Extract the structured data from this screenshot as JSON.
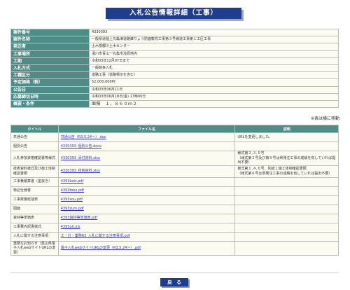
{
  "header": {
    "title": "入札公告情報詳細（工事）"
  },
  "info": [
    {
      "label": "案件番号",
      "value": "4330393"
    },
    {
      "label": "案件名称",
      "value": "一般県道陸上丸亀津道路維りょう防面軟充工事第３号線道工事第１工区工事"
    },
    {
      "label": "発注者",
      "value": "土木部都川土木センター"
    },
    {
      "label": "工事場所",
      "value": "湯川市青山一丸亀市浅見地内"
    },
    {
      "label": "工期",
      "value": "令和03年12月07日まで"
    },
    {
      "label": "入札方式",
      "value": "一般競争入札"
    },
    {
      "label": "工種区分",
      "value": "道路工事（道路標示を含む）"
    },
    {
      "label": "予定価格（税）",
      "value": "52,000,000円"
    },
    {
      "label": "公告日",
      "value": "令和03年06月11日"
    },
    {
      "label": "応募締切日時",
      "value": "令和03年06月18日(金) 17時00分"
    },
    {
      "label": "概要・条件",
      "value": "面積　１，８６０ｍ２"
    }
  ],
  "note": "※表は横に移動",
  "files": {
    "headers": [
      "タイトル",
      "ファイル名",
      "説明"
    ],
    "rows": [
      {
        "title": "共通公告",
        "file": "共通公告（R3.5.24～）.doc",
        "desc": "URLを変更しました。"
      },
      {
        "title": "個別公告",
        "file": "4330393_個別公告.docx",
        "desc": ""
      },
      {
        "title": "入札参加資格確認書等様式",
        "file": "4330393_添付資料.xlsx",
        "desc": "様式第２,３,５号\n（様式第３号及び第５号は県発注工事の成績を有していれば提出不要）"
      },
      {
        "title": "技術資料様式及び施工体制確認書類",
        "file": "4330393_技術資料.xlsx",
        "desc": "様式第１,４,６号、別紙１施工体制確認書類\n（様式第６号は県発注工事の成績を有していれば提出不要）"
      },
      {
        "title": "工事費積算書（金抜き）",
        "file": "4393kaki.pdf",
        "desc": ""
      },
      {
        "title": "特記仕様書",
        "file": "4393toku.pdf",
        "desc": ""
      },
      {
        "title": "工事数量総括表",
        "file": "4393sou.pdf",
        "desc": ""
      },
      {
        "title": "図面",
        "file": "4393zum.pdf",
        "desc": ""
      },
      {
        "title": "資材等単価表",
        "file": "4393資材等単価表.pdf",
        "desc": ""
      },
      {
        "title": "工事費内訳書様式",
        "file": "4393uti.xls",
        "desc": ""
      },
      {
        "title": "入札に関する注意事項",
        "file": "工・計・業務R2_入札に関する注意事項.pdf",
        "desc": ""
      },
      {
        "title": "重要なお知らせ（嘉山県電子入札webサイトURLの変更）",
        "file": "電子入札webサイトURLの変更（R3.5.24～）.pdf",
        "desc": ""
      }
    ]
  },
  "footer": {
    "back_label": "戻　る"
  }
}
